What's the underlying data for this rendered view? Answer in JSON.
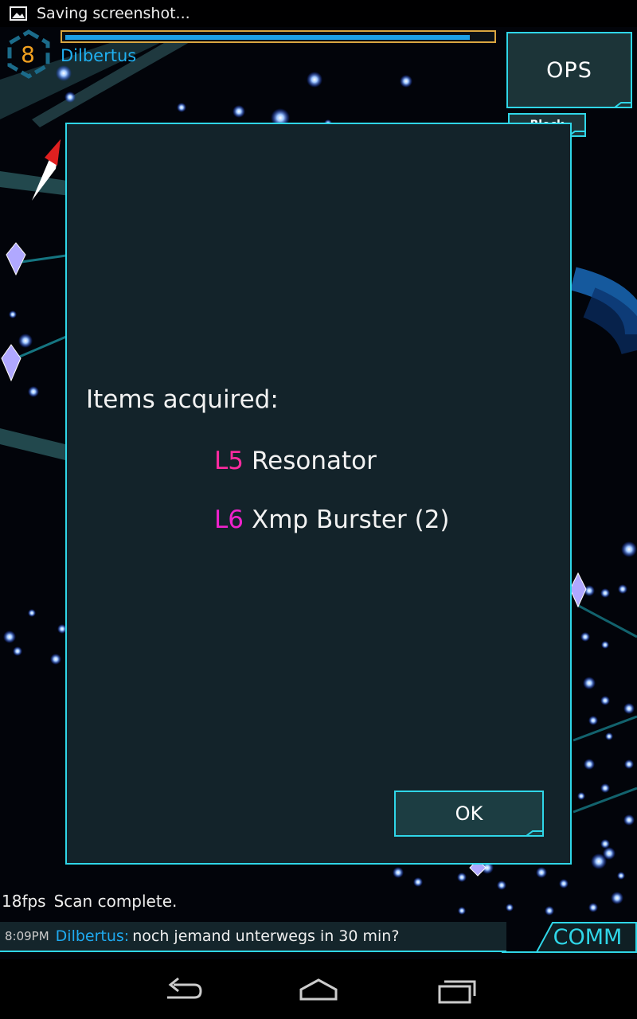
{
  "status_bar": {
    "notification_icon": "image-icon",
    "text": "Saving screenshot..."
  },
  "agent": {
    "level": "8",
    "name": "Dilbertus",
    "xm_fraction": 0.95
  },
  "ops": {
    "label": "OPS",
    "block_label": "Block"
  },
  "dialog": {
    "title": "Items acquired:",
    "items": [
      {
        "level": "L5",
        "name": "Resonator",
        "level_color": "#ff2ba0"
      },
      {
        "level": "L6",
        "name": "Xmp Burster (2)",
        "level_color": "#ee22cc"
      }
    ],
    "ok_label": "OK"
  },
  "hud": {
    "fps": "18fps",
    "scan_status": "Scan complete."
  },
  "comm": {
    "time": "8:09PM",
    "agent": "Dilbertus:",
    "message": "noch jemand unterwegs in 30 min?",
    "button_label": "COMM"
  },
  "nav": {
    "back_icon": "back-icon",
    "home_icon": "home-icon",
    "recents_icon": "recents-icon"
  },
  "colors": {
    "accent": "#2fd6e8",
    "agent_blue": "#1faaf0",
    "level_orange": "#f0a020",
    "panel": "#13232a"
  }
}
